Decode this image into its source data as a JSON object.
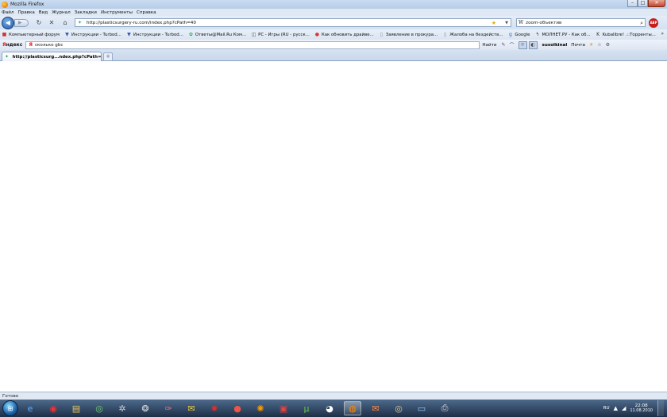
{
  "window": {
    "title": "Mozilla Firefox"
  },
  "menu": [
    "Файл",
    "Правка",
    "Вид",
    "Журнал",
    "Закладки",
    "Инструменты",
    "Справка"
  ],
  "navbar": {
    "url": "http://plasticsurgery-ru.com/index.php?cPath=40",
    "search_engine": "W",
    "search_value": "zoom-объектив"
  },
  "bookmarks": [
    {
      "label": "Компьютерный форум",
      "icon": "forum-icon"
    },
    {
      "label": "Инструкции - Turbod...",
      "icon": "turbo-icon"
    },
    {
      "label": "Инструкции - Turbod...",
      "icon": "turbo-icon"
    },
    {
      "label": "Ответы@Mail.Ru Ком...",
      "icon": "mail-icon"
    },
    {
      "label": "PC - Игры (RU - русск...",
      "icon": "pc-icon"
    },
    {
      "label": "Как обновить драйве...",
      "icon": "page-icon"
    },
    {
      "label": "Заявление в прокура...",
      "icon": "doc-icon"
    },
    {
      "label": "Жалоба на бездейств...",
      "icon": "doc-icon"
    },
    {
      "label": "Google",
      "icon": "google-icon"
    },
    {
      "label": "МОЛНЕТ.РУ - Как об...",
      "icon": "bolt-icon"
    },
    {
      "label": "Kubalibre! .::Торренты...",
      "icon": "k-icon"
    }
  ],
  "yandex": {
    "logo_red": "Я",
    "logo_rest": "ндекс",
    "query": "сколько gbc",
    "find_label": "Найти",
    "user": "susolkinal",
    "mail_label": "Почта"
  },
  "tabs": [
    {
      "label": "http://plasticsurg...ndex.php?cPath=40"
    }
  ],
  "status": {
    "text": "Готово"
  },
  "taskbar": {
    "lang": "RU",
    "time": "22:08",
    "date": "11.08.2010"
  }
}
